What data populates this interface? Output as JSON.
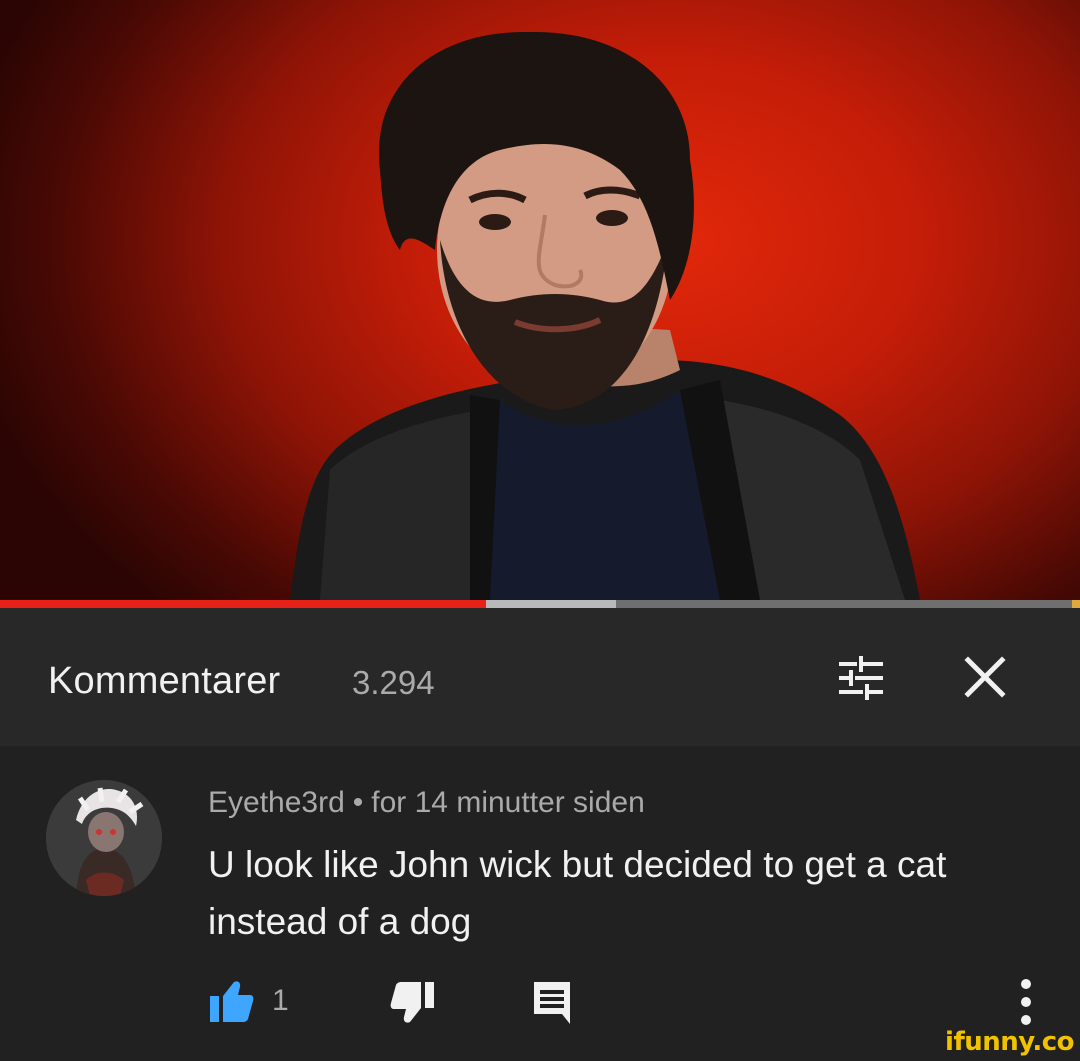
{
  "video": {
    "progress_played_fraction": 0.45,
    "progress_buffered_fraction": 0.57
  },
  "comments_panel": {
    "title": "Kommentarer",
    "count": "3.294",
    "sort_icon": "sort-filter-icon",
    "close_icon": "close-icon"
  },
  "comment": {
    "author": "Eyethe3rd",
    "separator": "•",
    "timestamp": "for 14 minutter siden",
    "text": "U look like John wick but decided to get a cat instead of a dog",
    "like_count": "1",
    "like_icon": "thumbs-up-icon",
    "dislike_icon": "thumbs-down-icon",
    "reply_icon": "reply-icon",
    "more_icon": "more-vertical-icon"
  },
  "watermark": {
    "text": "ifunny.co"
  },
  "colors": {
    "accent_red": "#e62117",
    "like_blue": "#3ea6ff",
    "panel_bg": "#212121",
    "header_bg": "#282828"
  }
}
